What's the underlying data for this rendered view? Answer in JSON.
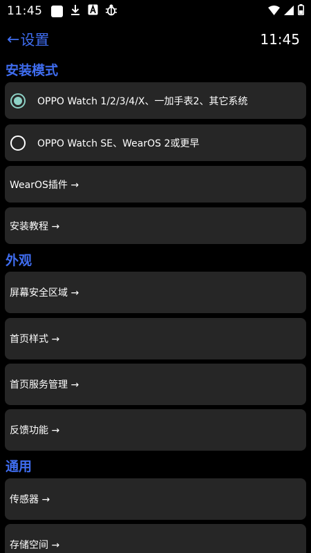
{
  "status_bar": {
    "time": "11:45",
    "left_icons": [
      "square-notification-icon",
      "download-icon",
      "font-app-icon",
      "bug-icon"
    ],
    "right_icons": [
      "wifi-icon",
      "signal-icon",
      "battery-icon"
    ]
  },
  "app_bar": {
    "back_label": "设置",
    "time": "11:45"
  },
  "sections": {
    "install_mode": {
      "title": "安装模式",
      "options": [
        {
          "label": "OPPO Watch 1/2/3/4/X、一加手表2、其它系统",
          "checked": true
        },
        {
          "label": "OPPO Watch SE、WearOS 2或更早",
          "checked": false
        }
      ],
      "items": [
        "WearOS插件 →",
        "安装教程 →"
      ]
    },
    "appearance": {
      "title": "外观",
      "items": [
        "屏幕安全区域 →",
        "首页样式 →",
        "首页服务管理 →",
        "反馈功能 →"
      ]
    },
    "general": {
      "title": "通用",
      "items": [
        "传感器 →",
        "存储空间 →"
      ]
    }
  }
}
